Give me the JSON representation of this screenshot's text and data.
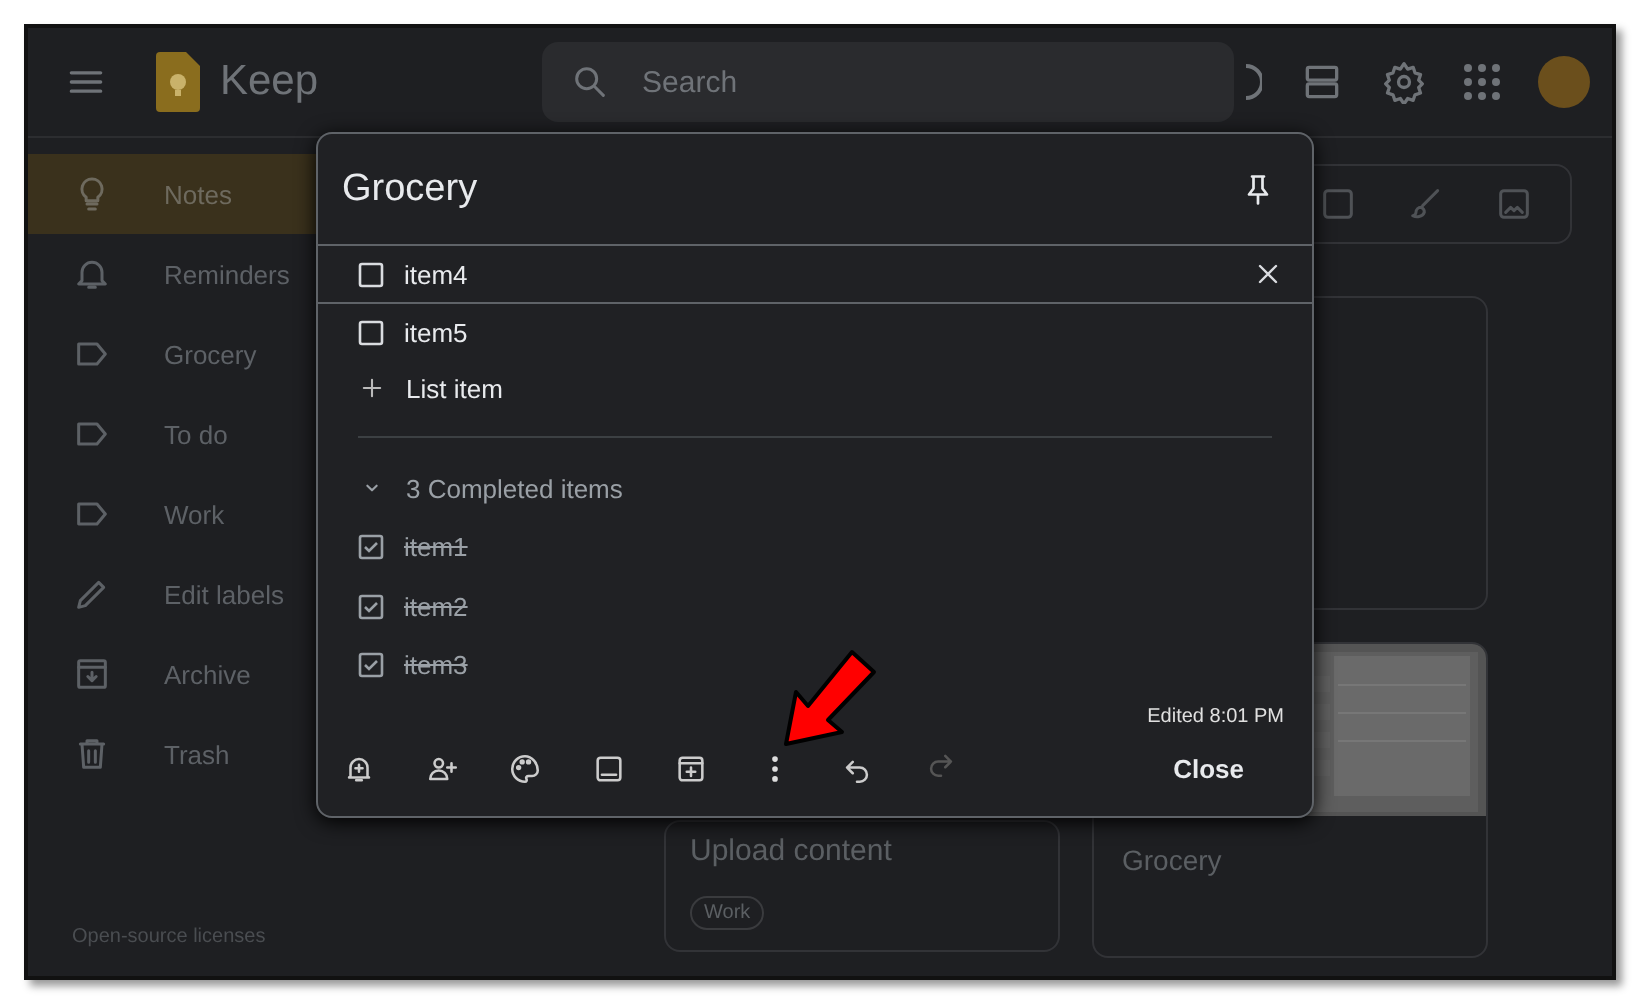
{
  "app": {
    "name": "Keep"
  },
  "search": {
    "placeholder": "Search"
  },
  "sidebar": {
    "items": [
      {
        "label": "Notes",
        "kind": "notes",
        "selected": true
      },
      {
        "label": "Reminders",
        "kind": "reminders",
        "selected": false
      },
      {
        "label": "Grocery",
        "kind": "label",
        "selected": false
      },
      {
        "label": "To do",
        "kind": "label",
        "selected": false
      },
      {
        "label": "Work",
        "kind": "label",
        "selected": false
      },
      {
        "label": "Edit labels",
        "kind": "edit",
        "selected": false
      },
      {
        "label": "Archive",
        "kind": "archive",
        "selected": false
      },
      {
        "label": "Trash",
        "kind": "trash",
        "selected": false
      }
    ],
    "footer": "Open-source licenses"
  },
  "notes": [
    {
      "kind": "text",
      "title": "Upload content",
      "labels": [
        "Work"
      ]
    },
    {
      "kind": "blank"
    },
    {
      "kind": "picture",
      "title": "Grocery"
    }
  ],
  "dialog": {
    "title": "Grocery",
    "items": [
      {
        "text": "item4",
        "checked": false,
        "focused": true
      },
      {
        "text": "item5",
        "checked": false,
        "focused": false
      }
    ],
    "add_item": "List item",
    "completed_header": "3 Completed items",
    "expanded": true,
    "completed": [
      {
        "text": "item1",
        "checked": true
      },
      {
        "text": "item2",
        "checked": true
      },
      {
        "text": "item3",
        "checked": true
      }
    ],
    "edited": "Edited 8:01 PM",
    "close": "Close"
  }
}
